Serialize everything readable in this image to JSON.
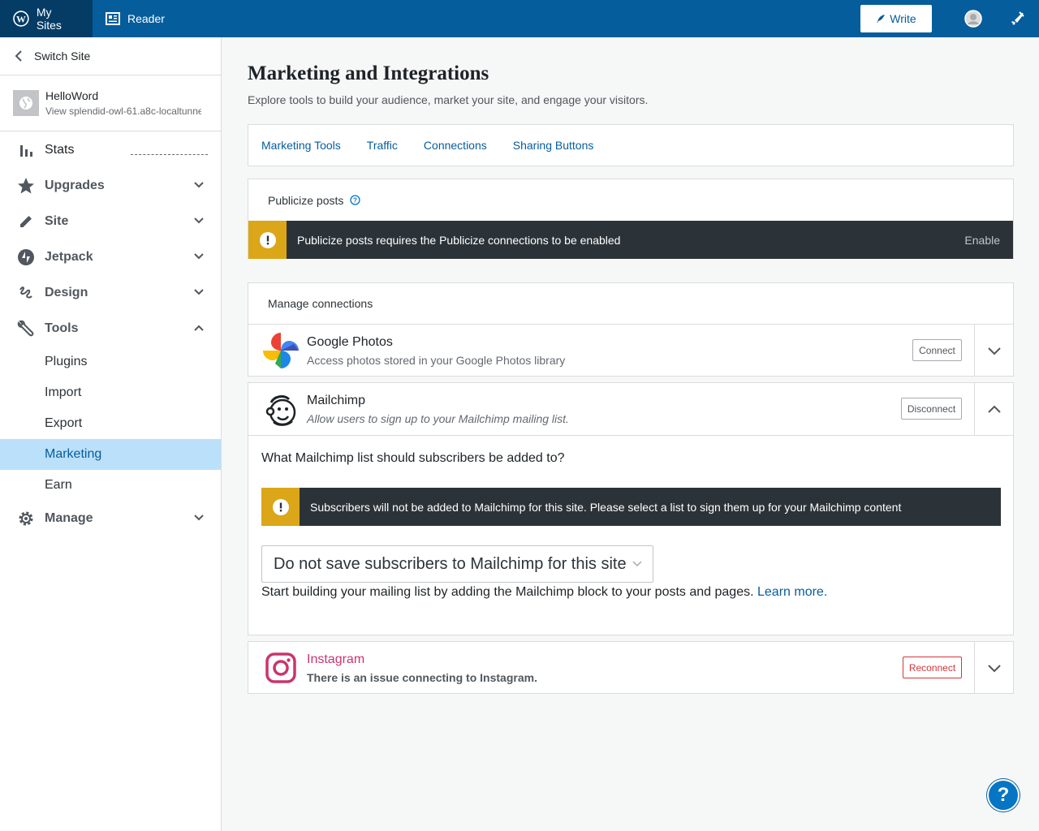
{
  "masterbar": {
    "my_sites": "My Sites",
    "reader": "Reader",
    "write": "Write"
  },
  "sidebar": {
    "switch_site": "Switch Site",
    "site_name": "HelloWord",
    "site_url": "View splendid-owl-61.a8c-localtunnel",
    "stats": "Stats",
    "upgrades": "Upgrades",
    "site": "Site",
    "jetpack": "Jetpack",
    "design": "Design",
    "tools": "Tools",
    "tools_items": [
      "Plugins",
      "Import",
      "Export",
      "Marketing",
      "Earn"
    ],
    "manage": "Manage"
  },
  "page": {
    "title": "Marketing and Integrations",
    "subtitle": "Explore tools to build your audience, market your site, and engage your visitors."
  },
  "tabs": [
    "Marketing Tools",
    "Traffic",
    "Connections",
    "Sharing Buttons"
  ],
  "publicize": {
    "heading": "Publicize posts",
    "notice": "Publicize posts requires the Publicize connections to be enabled",
    "action": "Enable"
  },
  "manage_connections": "Manage connections",
  "services": {
    "google_photos": {
      "name": "Google Photos",
      "desc": "Access photos stored in your Google Photos library",
      "button": "Connect"
    },
    "mailchimp": {
      "name": "Mailchimp",
      "desc": "Allow users to sign up to your Mailchimp mailing list.",
      "button": "Disconnect",
      "question": "What Mailchimp list should subscribers be added to?",
      "notice": "Subscribers will not be added to Mailchimp for this site. Please select a list to sign them up for your Mailchimp content",
      "select_value": "Do not save subscribers to Mailchimp for this site",
      "help_text": "Start building your mailing list by adding the Mailchimp block to your posts and pages.",
      "learn_more": "Learn more."
    },
    "instagram": {
      "name": "Instagram",
      "desc": "There is an issue connecting to Instagram.",
      "button": "Reconnect"
    }
  },
  "help_button": "?",
  "colors": {
    "masterbar": "#065d9c",
    "accent": "#065d9c",
    "warning": "#dba617",
    "notice_bg": "#2c3338",
    "error": "#d63638",
    "instagram": "#c9356e"
  }
}
